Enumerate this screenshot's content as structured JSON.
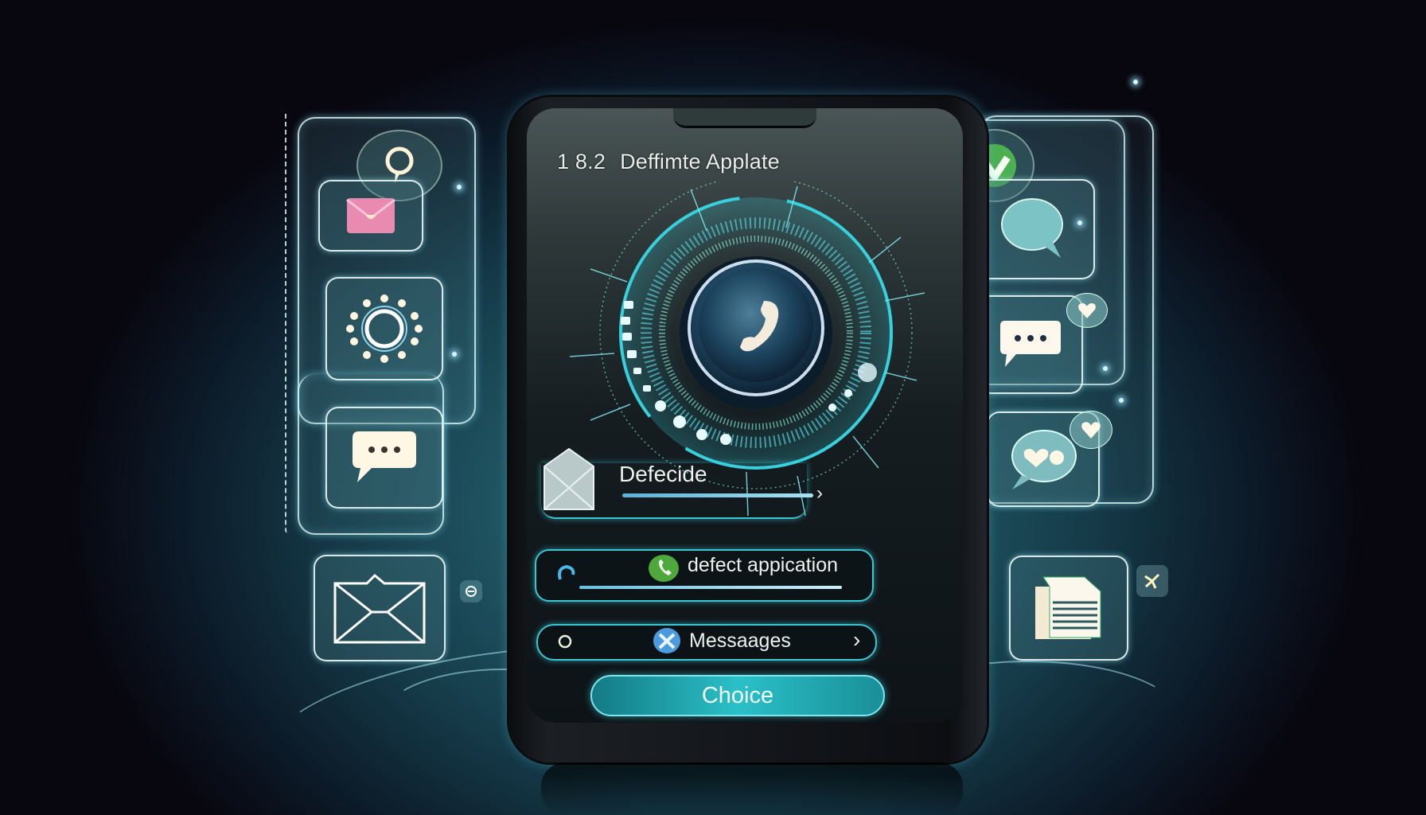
{
  "phone": {
    "header": {
      "version": "1 8.2",
      "title": "Deffimte Applate"
    },
    "dial": {
      "center_icon": "phone-handset-icon",
      "accent": "#38d0dc"
    },
    "rows": [
      {
        "icon": "envelope-icon",
        "label": "Defecide",
        "trailing": "chevron-right-icon",
        "progress_fraction": 1.0
      },
      {
        "leading": "refresh-arrow-icon",
        "icon": "green-phone-icon",
        "label": "defect appication",
        "progress_fraction": 1.0
      },
      {
        "leading": "circle-outline-icon",
        "icon": "blue-tools-icon",
        "label": "Messaages",
        "trailing": "chevron-right-icon"
      }
    ],
    "choice_button": {
      "label": "Choice",
      "color": "#2ac0c8"
    }
  },
  "left_panel": {
    "items": [
      {
        "icon": "search-bubble-icon"
      },
      {
        "icon": "pink-mail-icon",
        "color": "#e98ab0"
      },
      {
        "icon": "sun-dots-icon"
      },
      {
        "icon": "chat-dots-icon"
      }
    ],
    "bottom_tile": {
      "icon": "envelope-outline-icon"
    },
    "side_badge": {
      "icon": "minus-circle-icon"
    }
  },
  "right_panel": {
    "items": [
      {
        "icon": "green-check-badge-icon",
        "color": "#4caf50"
      },
      {
        "icon": "speech-bubble-icon"
      },
      {
        "icon": "chat-dots-heart-icon"
      },
      {
        "icon": "chat-heart-icon"
      }
    ],
    "bottom_tile": {
      "icon": "document-icon"
    },
    "side_badge": {
      "icon": "sparkle-badge-icon"
    }
  },
  "colors": {
    "background_dark": "#08060f",
    "background_teal": "#2f6e78",
    "glow": "#3bc6d4"
  }
}
